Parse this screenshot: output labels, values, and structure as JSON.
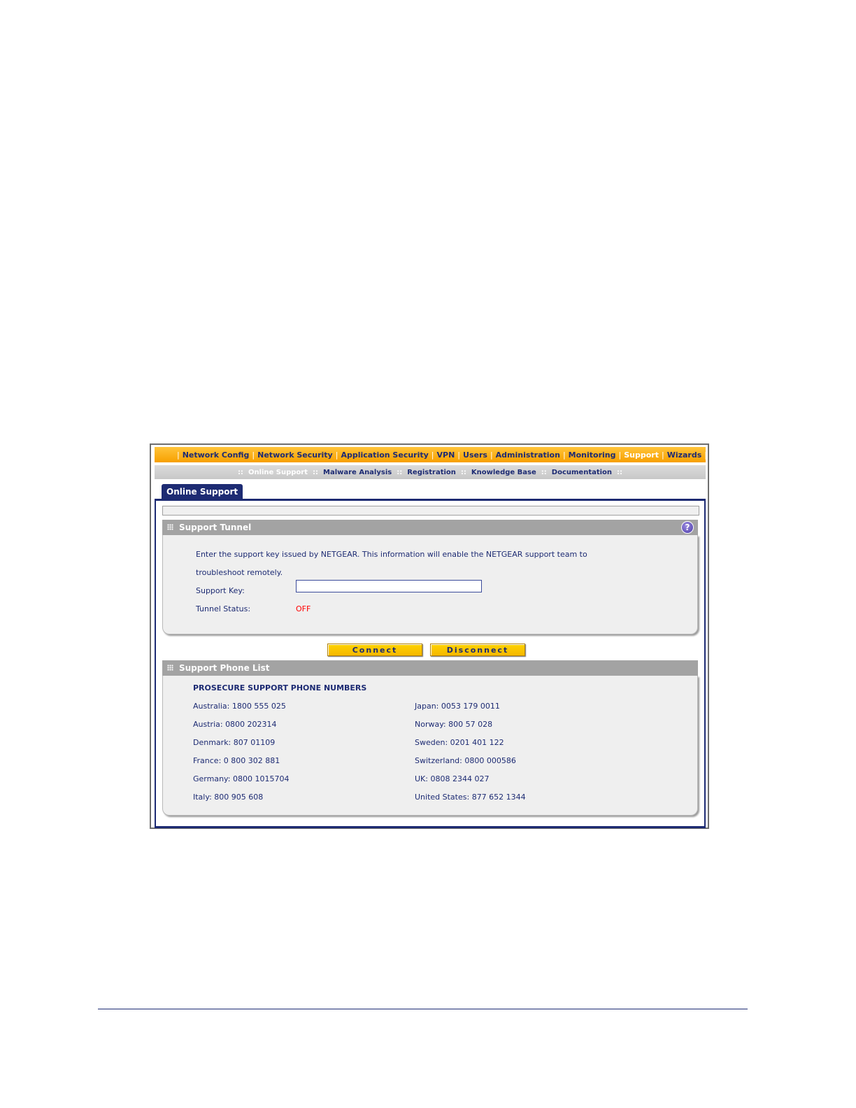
{
  "top_nav": {
    "items": [
      {
        "label": "Network Config",
        "active": false
      },
      {
        "label": "Network Security",
        "active": false
      },
      {
        "label": "Application Security",
        "active": false
      },
      {
        "label": "VPN",
        "active": false
      },
      {
        "label": "Users",
        "active": false
      },
      {
        "label": "Administration",
        "active": false
      },
      {
        "label": "Monitoring",
        "active": false
      },
      {
        "label": "Support",
        "active": true
      },
      {
        "label": "Wizards",
        "active": false
      }
    ]
  },
  "sub_nav": {
    "items": [
      {
        "label": "Online Support",
        "active": true
      },
      {
        "label": "Malware Analysis",
        "active": false
      },
      {
        "label": "Registration",
        "active": false
      },
      {
        "label": "Knowledge Base",
        "active": false
      },
      {
        "label": "Documentation",
        "active": false
      }
    ]
  },
  "tab": {
    "label": "Online Support"
  },
  "support_tunnel": {
    "title": "Support Tunnel",
    "description_line1": "Enter the support key issued by NETGEAR. This information will enable the NETGEAR support team to",
    "description_line2": "troubleshoot remotely.",
    "support_key_label": "Support Key:",
    "support_key_value": "",
    "tunnel_status_label": "Tunnel Status:",
    "tunnel_status_value": "OFF",
    "help_icon": "help-icon"
  },
  "buttons": {
    "connect": "Connect",
    "disconnect": "Disconnect"
  },
  "phone_list": {
    "title": "Support Phone List",
    "heading": "PROSECURE SUPPORT PHONE NUMBERS",
    "left": [
      "Australia: 1800 555 025",
      "Austria: 0800 202314",
      "Denmark: 807 01109",
      "France: 0 800 302 881",
      "Germany: 0800 1015704",
      "Italy: 800 905 608"
    ],
    "right": [
      "Japan: 0053 179 0011",
      "Norway: 800 57 028",
      "Sweden: 0201 401 122",
      "Switzerland: 0800 000586",
      "UK: 0808 2344 027",
      "United States: 877 652 1344"
    ]
  },
  "colors": {
    "nav_orange": "#f7a000",
    "navy": "#1d2b73",
    "button_yellow": "#ffd200",
    "status_off": "#ff0000"
  }
}
